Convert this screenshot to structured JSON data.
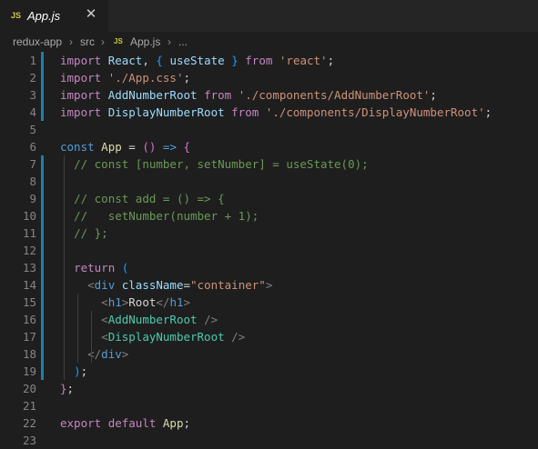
{
  "tab": {
    "icon_label": "JS",
    "title": "App.js",
    "close_icon": "close-icon"
  },
  "breadcrumb": {
    "items": [
      "redux-app",
      "src",
      "JS",
      "App.js",
      "..."
    ]
  },
  "editor": {
    "line_numbers": [
      "1",
      "2",
      "3",
      "4",
      "5",
      "6",
      "7",
      "8",
      "9",
      "10",
      "11",
      "12",
      "13",
      "14",
      "15",
      "16",
      "17",
      "18",
      "19",
      "20",
      "21",
      "22",
      "23"
    ],
    "lines": [
      [
        [
          "k",
          "import"
        ],
        [
          "p",
          " "
        ],
        [
          "v",
          "React"
        ],
        [
          "p",
          ", "
        ],
        [
          "bl",
          "{"
        ],
        [
          "p",
          " "
        ],
        [
          "v",
          "useState"
        ],
        [
          "p",
          " "
        ],
        [
          "bl",
          "}"
        ],
        [
          "p",
          " "
        ],
        [
          "k",
          "from"
        ],
        [
          "p",
          " "
        ],
        [
          "s",
          "'react'"
        ],
        [
          "p",
          ";"
        ]
      ],
      [
        [
          "k",
          "import"
        ],
        [
          "p",
          " "
        ],
        [
          "s",
          "'./App.css'"
        ],
        [
          "p",
          ";"
        ]
      ],
      [
        [
          "k",
          "import"
        ],
        [
          "p",
          " "
        ],
        [
          "v",
          "AddNumberRoot"
        ],
        [
          "p",
          " "
        ],
        [
          "k",
          "from"
        ],
        [
          "p",
          " "
        ],
        [
          "s",
          "'./components/AddNumberRoot'"
        ],
        [
          "p",
          ";"
        ]
      ],
      [
        [
          "k",
          "import"
        ],
        [
          "p",
          " "
        ],
        [
          "v",
          "DisplayNumberRoot"
        ],
        [
          "p",
          " "
        ],
        [
          "k",
          "from"
        ],
        [
          "p",
          " "
        ],
        [
          "s",
          "'./components/DisplayNumberRoot'"
        ],
        [
          "p",
          ";"
        ]
      ],
      [],
      [
        [
          "kb",
          "const"
        ],
        [
          "p",
          " "
        ],
        [
          "fn",
          "App"
        ],
        [
          "p",
          " = "
        ],
        [
          "pk",
          "("
        ],
        [
          "pk",
          ")"
        ],
        [
          "p",
          " "
        ],
        [
          "kb",
          "=>"
        ],
        [
          "p",
          " "
        ],
        [
          "pk",
          "{"
        ]
      ],
      [
        [
          "p",
          "  "
        ],
        [
          "c",
          "// const [number, setNumber] = useState(0);"
        ]
      ],
      [],
      [
        [
          "p",
          "  "
        ],
        [
          "c",
          "// const add = () => {"
        ]
      ],
      [
        [
          "p",
          "  "
        ],
        [
          "c",
          "//   setNumber(number + 1);"
        ]
      ],
      [
        [
          "p",
          "  "
        ],
        [
          "c",
          "// };"
        ]
      ],
      [],
      [
        [
          "p",
          "  "
        ],
        [
          "k",
          "return"
        ],
        [
          "p",
          " "
        ],
        [
          "bl",
          "("
        ]
      ],
      [
        [
          "p",
          "    "
        ],
        [
          "tagp",
          "<"
        ],
        [
          "tag",
          "div"
        ],
        [
          "p",
          " "
        ],
        [
          "v",
          "className"
        ],
        [
          "p",
          "="
        ],
        [
          "s",
          "\"container\""
        ],
        [
          "tagp",
          ">"
        ]
      ],
      [
        [
          "p",
          "      "
        ],
        [
          "tagp",
          "<"
        ],
        [
          "tag",
          "h1"
        ],
        [
          "tagp",
          ">"
        ],
        [
          "p",
          "Root"
        ],
        [
          "tagp",
          "</"
        ],
        [
          "tag",
          "h1"
        ],
        [
          "tagp",
          ">"
        ]
      ],
      [
        [
          "p",
          "      "
        ],
        [
          "tagp",
          "<"
        ],
        [
          "comp",
          "AddNumberRoot"
        ],
        [
          "p",
          " "
        ],
        [
          "tagp",
          "/>"
        ]
      ],
      [
        [
          "p",
          "      "
        ],
        [
          "tagp",
          "<"
        ],
        [
          "comp",
          "DisplayNumberRoot"
        ],
        [
          "p",
          " "
        ],
        [
          "tagp",
          "/>"
        ]
      ],
      [
        [
          "p",
          "    "
        ],
        [
          "tagp",
          "</"
        ],
        [
          "tag",
          "div"
        ],
        [
          "tagp",
          ">"
        ]
      ],
      [
        [
          "p",
          "  "
        ],
        [
          "bl",
          ")"
        ],
        [
          "p",
          ";"
        ]
      ],
      [
        [
          "pk",
          "}"
        ],
        [
          "p",
          ";"
        ]
      ],
      [],
      [
        [
          "k",
          "export"
        ],
        [
          "p",
          " "
        ],
        [
          "k",
          "default"
        ],
        [
          "p",
          " "
        ],
        [
          "fn",
          "App"
        ],
        [
          "p",
          ";"
        ]
      ],
      []
    ],
    "modified_lines": [
      "1",
      "2",
      "3",
      "4",
      "7",
      "8",
      "9",
      "10",
      "11",
      "12",
      "13",
      "14",
      "15",
      "16",
      "17",
      "18",
      "19"
    ]
  },
  "colors": {
    "background": "#1e1e1e",
    "gutter_modified": "#1b81a8"
  }
}
